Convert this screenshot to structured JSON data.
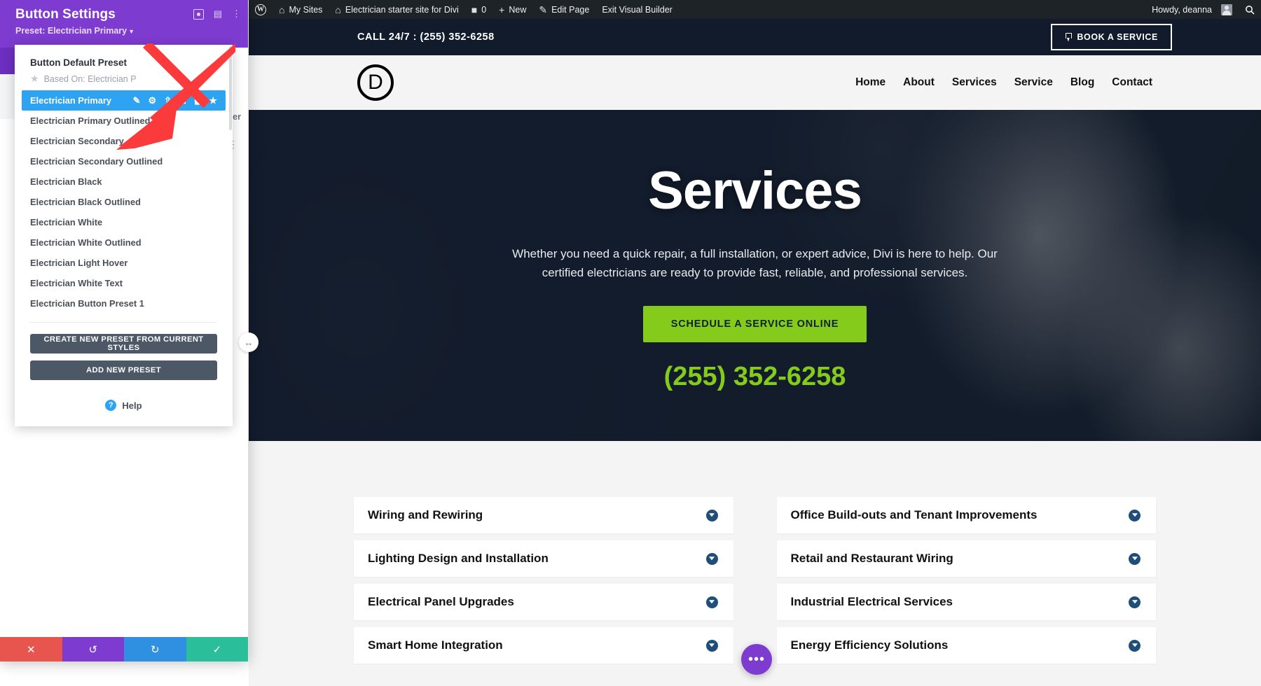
{
  "admin_bar": {
    "wp_logo": "W",
    "items": [
      {
        "icon": "sites-icon",
        "glyph": "⌂",
        "label": "My Sites"
      },
      {
        "icon": "site-icon",
        "glyph": "⌂",
        "label": "Electrician starter site for Divi"
      },
      {
        "icon": "comment-icon",
        "glyph": "■",
        "label": "0"
      },
      {
        "icon": "plus-icon",
        "glyph": "+",
        "label": "New"
      },
      {
        "icon": "pencil-icon",
        "glyph": "✎",
        "label": "Edit Page"
      },
      {
        "icon": "",
        "glyph": "",
        "label": "Exit Visual Builder"
      }
    ],
    "howdy": "Howdy, deanna",
    "search_icon": "search-icon"
  },
  "site": {
    "topbar": {
      "phone_label": "CALL 24/7 : (255) 352-6258",
      "cta_label": "BOOK A SERVICE",
      "cta_icon": "plug-icon"
    },
    "header": {
      "logo_letter": "D",
      "nav": [
        {
          "label": "Home"
        },
        {
          "label": "About"
        },
        {
          "label": "Services"
        },
        {
          "label": "Service"
        },
        {
          "label": "Blog"
        },
        {
          "label": "Contact"
        }
      ]
    },
    "hero": {
      "title": "Services",
      "subtitle": "Whether you need a quick repair, a full installation, or expert advice, Divi is here to help. Our certified electricians are ready to provide fast, reliable, and professional services.",
      "button_label": "SCHEDULE A SERVICE ONLINE",
      "phone": "(255) 352-6258",
      "button_color": "#85cb1c",
      "phone_color": "#85cb1c",
      "background_color": "#121b2b"
    },
    "services": {
      "toggle_icon": "circle-arrow-down-icon",
      "left_column": [
        {
          "title": "Wiring and Rewiring"
        },
        {
          "title": "Lighting Design and Installation"
        },
        {
          "title": "Electrical Panel Upgrades"
        },
        {
          "title": "Smart Home Integration"
        }
      ],
      "right_column": [
        {
          "title": "Office Build-outs and Tenant Improvements"
        },
        {
          "title": "Retail and Restaurant Wiring"
        },
        {
          "title": "Industrial Electrical Services"
        },
        {
          "title": "Energy Efficiency Solutions"
        }
      ]
    },
    "fab_label": "•••",
    "drag_handle_icon": "horizontal-resize-icon"
  },
  "modal": {
    "title": "Button Settings",
    "preset_label": "Preset: Electrician Primary",
    "header_color": "#7e3bd0",
    "head_icons": [
      {
        "name": "focus-icon",
        "glyph": ""
      },
      {
        "name": "window-mode-icon",
        "glyph": "▤"
      },
      {
        "name": "kebab-menu-icon",
        "glyph": "⋮"
      }
    ],
    "behind_tab_label": "er",
    "behind_kebab": "⋮",
    "preset_panel": {
      "default_preset_name": "Button Default Preset",
      "based_on_label": "Based On: Electrician P",
      "based_on_icon": "star-icon",
      "active_preset": "Electrician Primary",
      "active_icons": [
        {
          "name": "pencil-edit-icon",
          "glyph": "✎"
        },
        {
          "name": "gear-settings-icon",
          "glyph": "⚙"
        },
        {
          "name": "export-upload-icon",
          "glyph": "⇧"
        },
        {
          "name": "duplicate-icon",
          "glyph": "⧉"
        },
        {
          "name": "trash-delete-icon",
          "glyph": "Ὕ1"
        },
        {
          "name": "star-default-icon",
          "glyph": "★"
        }
      ],
      "presets": [
        {
          "label": "Electrician Primary Outlined"
        },
        {
          "label": "Electrician Secondary"
        },
        {
          "label": "Electrician Secondary Outlined"
        },
        {
          "label": "Electrician Black"
        },
        {
          "label": "Electrician Black Outlined"
        },
        {
          "label": "Electrician White"
        },
        {
          "label": "Electrician White Outlined"
        },
        {
          "label": "Electrician Light Hover"
        },
        {
          "label": "Electrician White Text"
        },
        {
          "label": "Electrician Button Preset 1"
        }
      ],
      "create_preset_label": "CREATE NEW PRESET FROM CURRENT STYLES",
      "add_preset_label": "ADD NEW PRESET",
      "help_label": "Help",
      "help_icon": "question-mark-icon"
    },
    "footer": [
      {
        "name": "cancel-button",
        "glyph": "✕",
        "color": "#e8554e"
      },
      {
        "name": "undo-button",
        "glyph": "↺",
        "color": "#7e3bd0"
      },
      {
        "name": "redo-button",
        "glyph": "↻",
        "color": "#2f8fe0"
      },
      {
        "name": "save-button",
        "glyph": "✓",
        "color": "#2bbe9a"
      }
    ]
  },
  "annotation": {
    "arrow_color": "#fb3b3b"
  }
}
